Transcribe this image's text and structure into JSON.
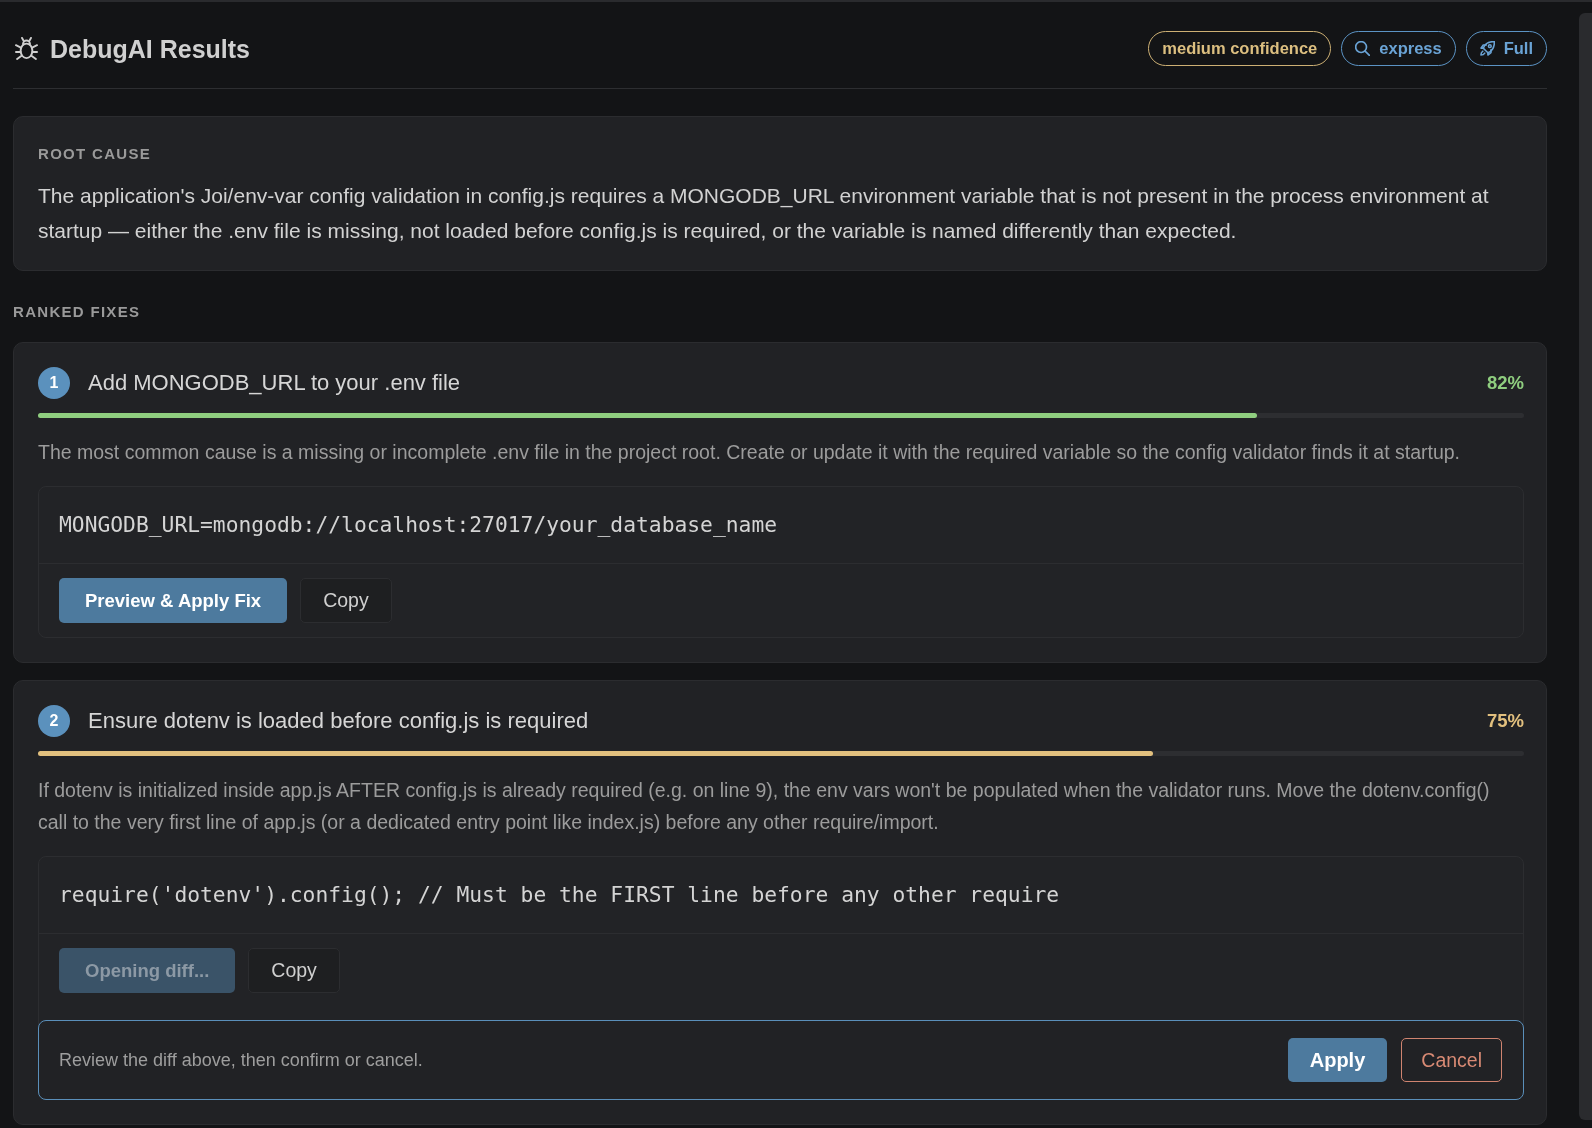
{
  "header": {
    "title": "DebugAI Results",
    "badges": [
      {
        "kind": "confidence",
        "label": "medium confidence"
      },
      {
        "kind": "framework",
        "label": "express"
      },
      {
        "kind": "mode",
        "label": "Full"
      }
    ]
  },
  "root_cause": {
    "label": "ROOT CAUSE",
    "text": "The application's Joi/env-var config validation in config.js requires a MONGODB_URL environment variable that is not present in the process environment at startup — either the .env file is missing, not loaded before config.js is required, or the variable is named differently than expected."
  },
  "fixes_label": "RANKED FIXES",
  "fixes": [
    {
      "number": "1",
      "title": "Add MONGODB_URL to your .env file",
      "confidence": "82%",
      "level": 0.82,
      "color": "#8fce7f",
      "description": "The most common cause is a missing or incomplete .env file in the project root. Create or update it with the required variable so the config validator finds it at startup.",
      "code": "MONGODB_URL=mongodb://localhost:27017/your_database_name",
      "actions": [
        {
          "kind": "primary",
          "label": "Preview & Apply Fix",
          "disabled": false
        },
        {
          "kind": "secondary",
          "label": "Copy",
          "disabled": false
        }
      ]
    },
    {
      "number": "2",
      "title": "Ensure dotenv is loaded before config.js is required",
      "confidence": "75%",
      "level": 0.75,
      "color": "#e2c07e",
      "description": "If dotenv is initialized inside app.js AFTER config.js is already required (e.g. on line 9), the env vars won't be populated when the validator runs. Move the dotenv.config() call to the very first line of app.js (or a dedicated entry point like index.js) before any other require/import.",
      "code": "require('dotenv').config(); // Must be the FIRST line before any other require",
      "actions": [
        {
          "kind": "primary",
          "label": "Opening diff...",
          "disabled": true
        },
        {
          "kind": "secondary",
          "label": "Copy",
          "disabled": false
        }
      ],
      "confirm": {
        "message": "Review the diff above, then confirm or cancel.",
        "actions": [
          {
            "kind": "primary",
            "label": "Apply"
          },
          {
            "kind": "danger",
            "label": "Cancel"
          }
        ]
      }
    }
  ]
}
